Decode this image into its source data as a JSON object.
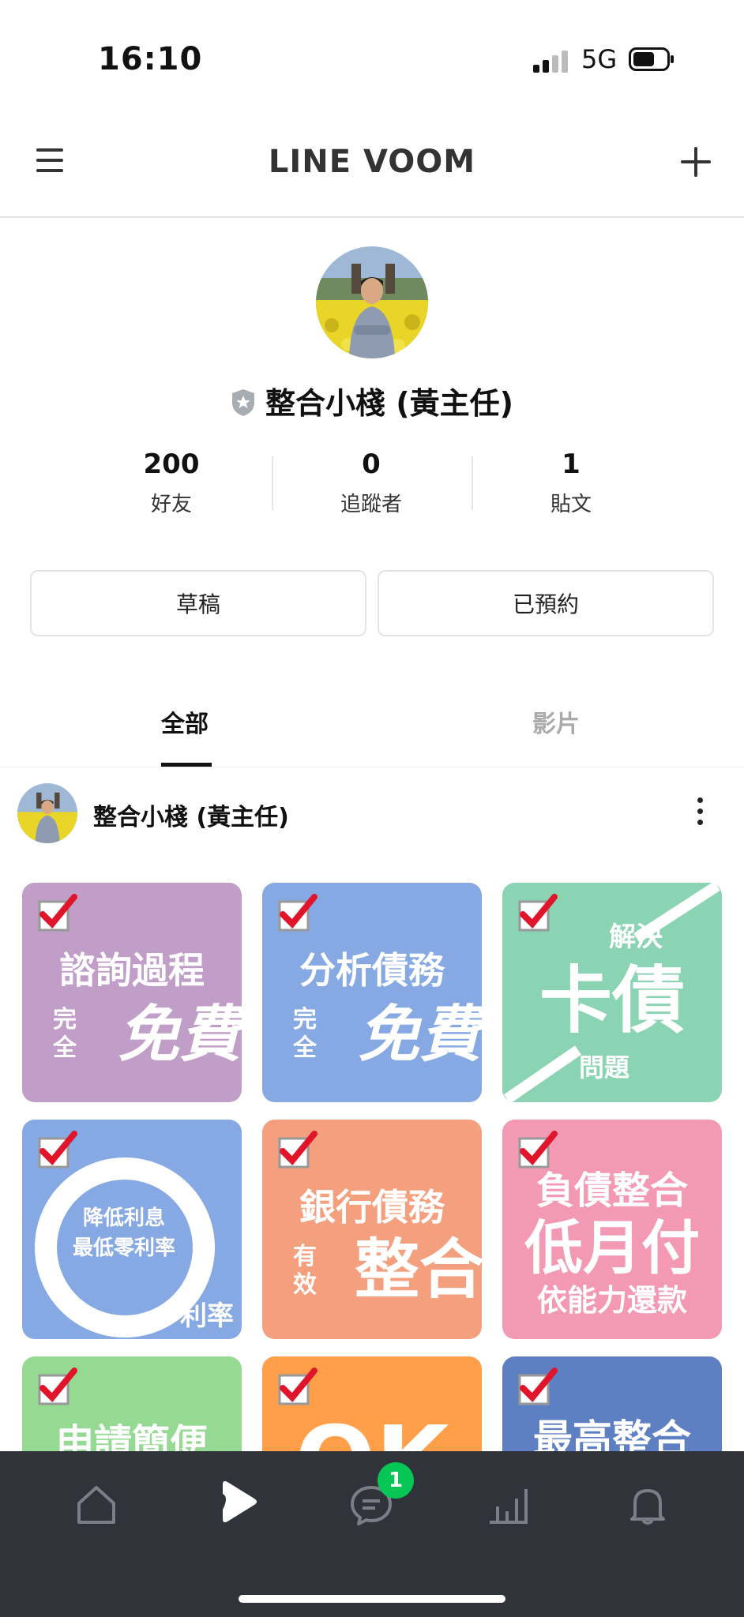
{
  "status_bar": {
    "time": "16:10",
    "network": "5G"
  },
  "header": {
    "title": "LINE VOOM"
  },
  "profile": {
    "name": "整合小棧 (黃主任)",
    "stats": [
      {
        "value": "200",
        "label": "好友"
      },
      {
        "value": "0",
        "label": "追蹤者"
      },
      {
        "value": "1",
        "label": "貼文"
      }
    ],
    "buttons": {
      "drafts": "草稿",
      "scheduled": "已預約"
    }
  },
  "tabs": {
    "all": "全部",
    "video": "影片",
    "active": "全部"
  },
  "post": {
    "author": "整合小棧 (黃主任)",
    "tiles": [
      {
        "lines": [
          "諮詢過程",
          "完全",
          "免費"
        ],
        "color": "#c09ec7"
      },
      {
        "lines": [
          "分析債務",
          "完全",
          "免費"
        ],
        "color": "#87a9e3"
      },
      {
        "lines": [
          "解決",
          "卡債",
          "問題"
        ],
        "color": "#8ad3b3"
      },
      {
        "lines": [
          "降低利息",
          "最低零利率",
          "利率"
        ],
        "color": "#87a9e3"
      },
      {
        "lines": [
          "銀行債務",
          "有效",
          "整合"
        ],
        "color": "#f4a07f"
      },
      {
        "lines": [
          "負債整合",
          "低月付",
          "依能力還款"
        ],
        "color": "#f499b4"
      },
      {
        "lines": [
          "申請簡便"
        ],
        "color": "#96d993"
      },
      {
        "lines": [
          "OK"
        ],
        "color": "#ff9f4a"
      },
      {
        "lines": [
          "最高整合"
        ],
        "color": "#5f7fc3"
      }
    ]
  },
  "bottom_nav": {
    "items": [
      "home-icon",
      "voom-icon",
      "chat-icon",
      "stats-icon",
      "bell-icon"
    ],
    "active": "voom-icon",
    "chat_badge": "1"
  },
  "colors": {
    "accent_green": "#06c755",
    "nav_bg": "#31333a",
    "check_red": "#e0152b"
  }
}
